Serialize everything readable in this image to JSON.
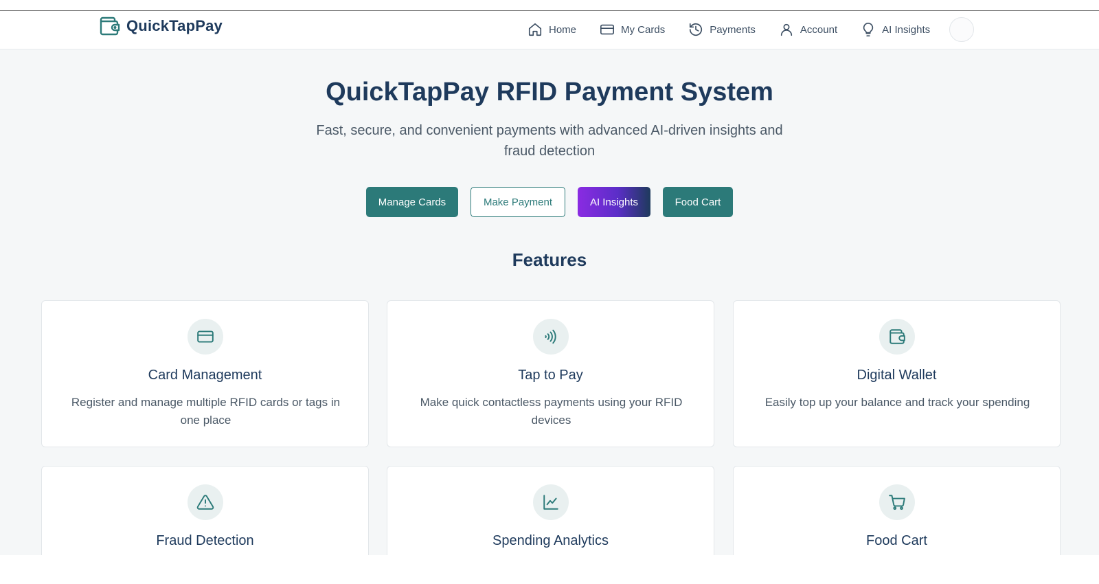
{
  "brand": {
    "name": "QuickTapPay",
    "icon": "wallet-icon"
  },
  "nav": {
    "items": [
      {
        "label": "Home",
        "icon": "home-icon"
      },
      {
        "label": "My Cards",
        "icon": "credit-card-icon"
      },
      {
        "label": "Payments",
        "icon": "history-icon"
      },
      {
        "label": "Account",
        "icon": "user-icon"
      },
      {
        "label": "AI Insights",
        "icon": "lightbulb-icon"
      }
    ],
    "avatar": "avatar"
  },
  "hero": {
    "title": "QuickTapPay RFID Payment System",
    "subtitle": "Fast, secure, and convenient payments with advanced AI-driven insights and fraud detection",
    "buttons": {
      "manage_cards": "Manage Cards",
      "make_payment": "Make Payment",
      "ai_insights": "AI Insights",
      "food_cart": "Food Cart"
    }
  },
  "features": {
    "title": "Features",
    "cards": [
      {
        "title": "Card Management",
        "description": "Register and manage multiple RFID cards or tags in one place",
        "icon": "credit-card-icon"
      },
      {
        "title": "Tap to Pay",
        "description": "Make quick contactless payments using your RFID devices",
        "icon": "contactless-icon"
      },
      {
        "title": "Digital Wallet",
        "description": "Easily top up your balance and track your spending",
        "icon": "wallet-icon"
      },
      {
        "title": "Fraud Detection",
        "description": "",
        "icon": "alert-triangle-icon"
      },
      {
        "title": "Spending Analytics",
        "description": "",
        "icon": "line-chart-icon"
      },
      {
        "title": "Food Cart",
        "description": "",
        "icon": "shopping-cart-icon"
      }
    ]
  },
  "colors": {
    "primary": "#2c7a79",
    "heading": "#1e3a5c",
    "text": "#4a5866",
    "background": "#f5f7f8",
    "ai_gradient_start": "#8a2be2",
    "ai_gradient_end": "#1e3a5c"
  }
}
